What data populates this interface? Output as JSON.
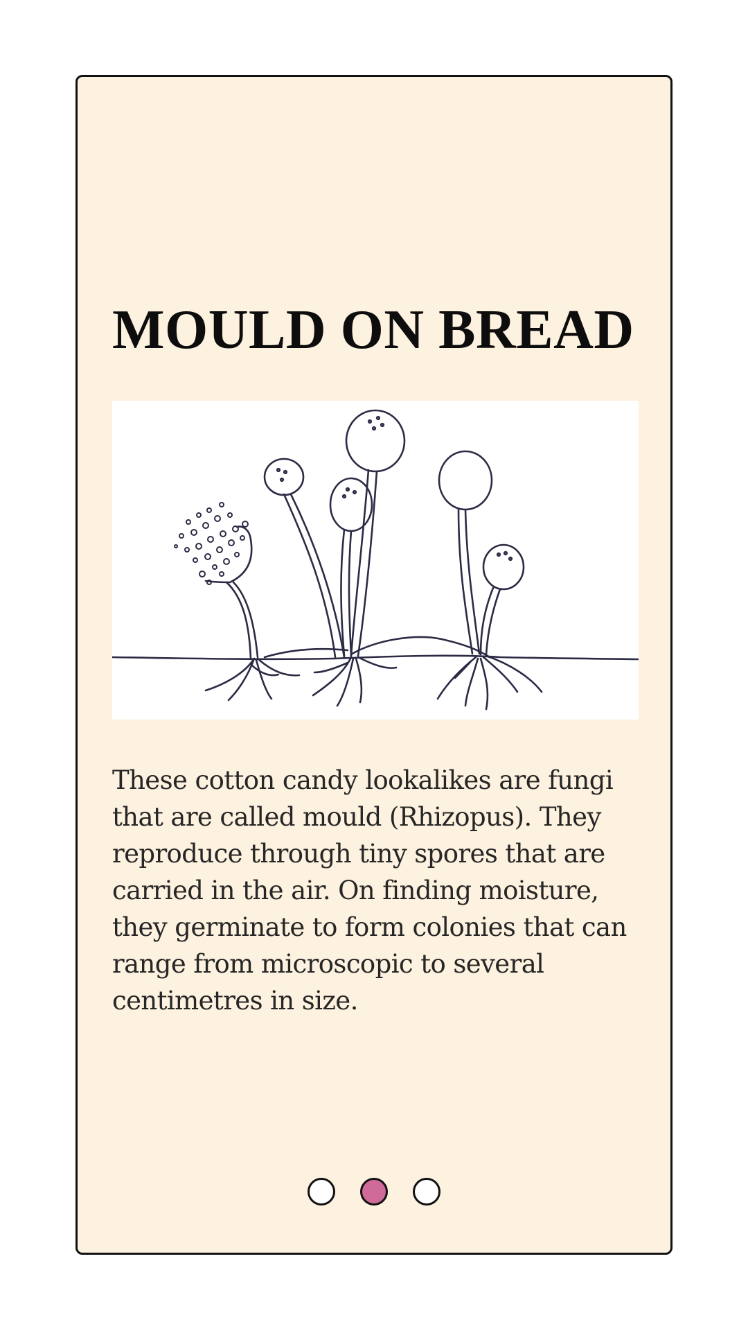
{
  "card": {
    "title": "MOULD ON BREAD",
    "illustration_name": "rhizopus-mould-drawing",
    "body": "These cotton candy lookalikes are fungi that are called mould (Rhizopus). They reproduce through tiny spores that are carried in the air. On finding moisture, they germinate to form colonies that can range from microscopic to several centimetres in size."
  },
  "pager": {
    "total": 3,
    "active_index": 1,
    "active_color": "#d06a98"
  },
  "colors": {
    "card_background": "#fdf1df",
    "border": "#111111",
    "ink": "#2b2b45"
  }
}
